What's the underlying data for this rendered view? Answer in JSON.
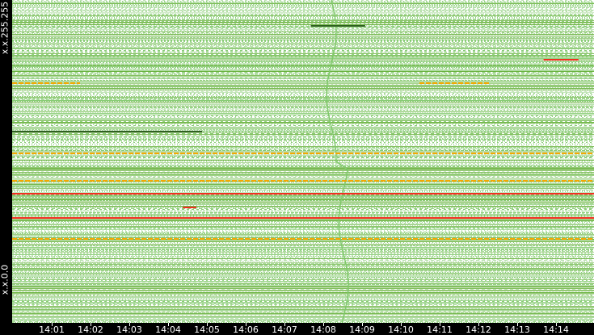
{
  "chart_data": {
    "type": "heatmap",
    "title": "",
    "ylabel_top": "x.x.255.255",
    "ylabel_bottom": "x.x.0.0",
    "x_ticks": [
      "14:01",
      "14:02",
      "14:03",
      "14:04",
      "14:05",
      "14:06",
      "14:07",
      "14:08",
      "14:09",
      "14:10",
      "14:11",
      "14:12",
      "14:13",
      "14:14"
    ],
    "x_range_minutes": [
      0,
      15
    ],
    "y_range": [
      0,
      1
    ],
    "colors": {
      "base": "#7fc86a",
      "dense": "#5aaa2a",
      "orange": "#f5a800",
      "red": "#f03020",
      "dark": "#2f5f20"
    },
    "background_rows": 400,
    "highlight_flows": [
      {
        "y": 0.4,
        "t0": 0,
        "t1": 15,
        "color": "red"
      },
      {
        "y": 0.525,
        "t0": 0,
        "t1": 15,
        "color": "orange"
      },
      {
        "y": 0.7425,
        "t0": 0,
        "t1": 1.75,
        "color": "orange"
      },
      {
        "y": 0.7425,
        "t0": 10.5,
        "t1": 12.3,
        "color": "orange"
      },
      {
        "y": 0.3575,
        "t0": 4.4,
        "t1": 4.75,
        "color": "red"
      },
      {
        "y": 0.325,
        "t0": 0,
        "t1": 15,
        "color": "red"
      },
      {
        "y": 0.5925,
        "t0": 0,
        "t1": 4.9,
        "color": "dark"
      },
      {
        "y": 0.44,
        "t0": 0,
        "t1": 15,
        "color": "orange"
      },
      {
        "y": 0.26,
        "t0": 0,
        "t1": 15,
        "color": "orange"
      },
      {
        "y": 0.815,
        "t0": 13.7,
        "t1": 14.6,
        "color": "red"
      },
      {
        "y": 0.92,
        "t0": 7.7,
        "t1": 9.1,
        "color": "dark"
      }
    ]
  }
}
